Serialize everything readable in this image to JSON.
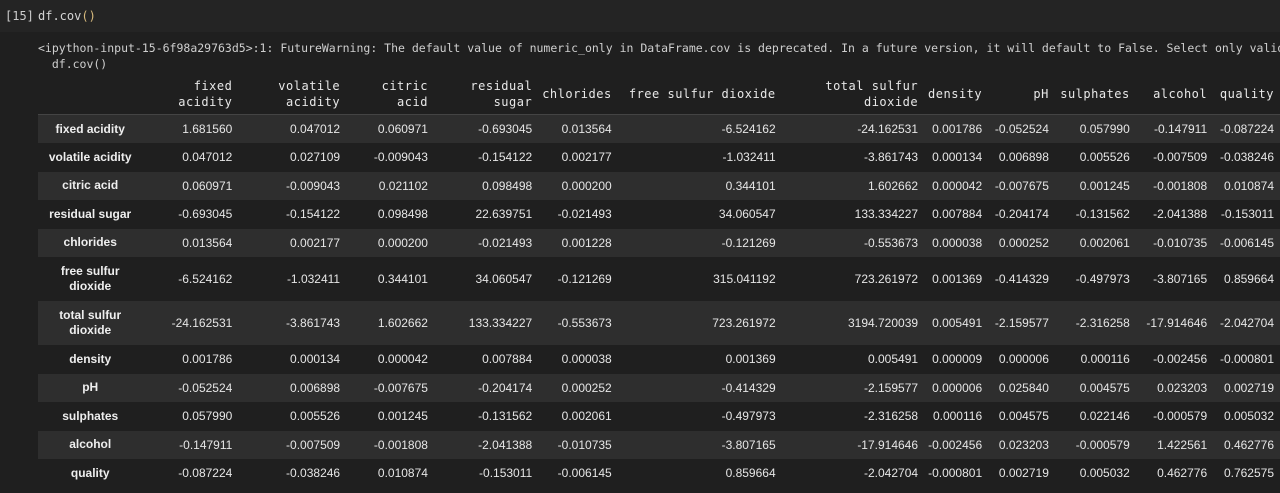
{
  "cell": {
    "prompt": "[15]",
    "code_prefix": "df.cov",
    "code_paren": "()"
  },
  "output": {
    "warning_line1": "<ipython-input-15-6f98a29763d5>:1: FutureWarning: The default value of numeric_only in DataFrame.cov is deprecated. In a future version, it will default to False. Select only valid columns or",
    "warning_line2": "  df.cov()"
  },
  "table": {
    "columns": [
      "fixed acidity",
      "volatile acidity",
      "citric acid",
      "residual sugar",
      "chlorides",
      "free sulfur dioxide",
      "total sulfur dioxide",
      "density",
      "pH",
      "sulphates",
      "alcohol",
      "quality"
    ],
    "rows": [
      {
        "label": "fixed acidity",
        "values": [
          "1.681560",
          "0.047012",
          "0.060971",
          "-0.693045",
          "0.013564",
          "-6.524162",
          "-24.162531",
          "0.001786",
          "-0.052524",
          "0.057990",
          "-0.147911",
          "-0.087224"
        ]
      },
      {
        "label": "volatile acidity",
        "values": [
          "0.047012",
          "0.027109",
          "-0.009043",
          "-0.154122",
          "0.002177",
          "-1.032411",
          "-3.861743",
          "0.000134",
          "0.006898",
          "0.005526",
          "-0.007509",
          "-0.038246"
        ]
      },
      {
        "label": "citric acid",
        "values": [
          "0.060971",
          "-0.009043",
          "0.021102",
          "0.098498",
          "0.000200",
          "0.344101",
          "1.602662",
          "0.000042",
          "-0.007675",
          "0.001245",
          "-0.001808",
          "0.010874"
        ]
      },
      {
        "label": "residual sugar",
        "values": [
          "-0.693045",
          "-0.154122",
          "0.098498",
          "22.639751",
          "-0.021493",
          "34.060547",
          "133.334227",
          "0.007884",
          "-0.204174",
          "-0.131562",
          "-2.041388",
          "-0.153011"
        ]
      },
      {
        "label": "chlorides",
        "values": [
          "0.013564",
          "0.002177",
          "0.000200",
          "-0.021493",
          "0.001228",
          "-0.121269",
          "-0.553673",
          "0.000038",
          "0.000252",
          "0.002061",
          "-0.010735",
          "-0.006145"
        ]
      },
      {
        "label": "free sulfur dioxide",
        "values": [
          "-6.524162",
          "-1.032411",
          "0.344101",
          "34.060547",
          "-0.121269",
          "315.041192",
          "723.261972",
          "0.001369",
          "-0.414329",
          "-0.497973",
          "-3.807165",
          "0.859664"
        ]
      },
      {
        "label": "total sulfur dioxide",
        "values": [
          "-24.162531",
          "-3.861743",
          "1.602662",
          "133.334227",
          "-0.553673",
          "723.261972",
          "3194.720039",
          "0.005491",
          "-2.159577",
          "-2.316258",
          "-17.914646",
          "-2.042704"
        ]
      },
      {
        "label": "density",
        "values": [
          "0.001786",
          "0.000134",
          "0.000042",
          "0.007884",
          "0.000038",
          "0.001369",
          "0.005491",
          "0.000009",
          "0.000006",
          "0.000116",
          "-0.002456",
          "-0.000801"
        ]
      },
      {
        "label": "pH",
        "values": [
          "-0.052524",
          "0.006898",
          "-0.007675",
          "-0.204174",
          "0.000252",
          "-0.414329",
          "-2.159577",
          "0.000006",
          "0.025840",
          "0.004575",
          "0.023203",
          "0.002719"
        ]
      },
      {
        "label": "sulphates",
        "values": [
          "0.057990",
          "0.005526",
          "0.001245",
          "-0.131562",
          "0.002061",
          "-0.497973",
          "-2.316258",
          "0.000116",
          "0.004575",
          "0.022146",
          "-0.000579",
          "0.005032"
        ]
      },
      {
        "label": "alcohol",
        "values": [
          "-0.147911",
          "-0.007509",
          "-0.001808",
          "-2.041388",
          "-0.010735",
          "-3.807165",
          "-17.914646",
          "-0.002456",
          "0.023203",
          "-0.000579",
          "1.422561",
          "0.462776"
        ]
      },
      {
        "label": "quality",
        "values": [
          "-0.087224",
          "-0.038246",
          "0.010874",
          "-0.153011",
          "-0.006145",
          "0.859664",
          "-2.042704",
          "-0.000801",
          "0.002719",
          "0.005032",
          "0.462776",
          "0.762575"
        ]
      }
    ]
  }
}
